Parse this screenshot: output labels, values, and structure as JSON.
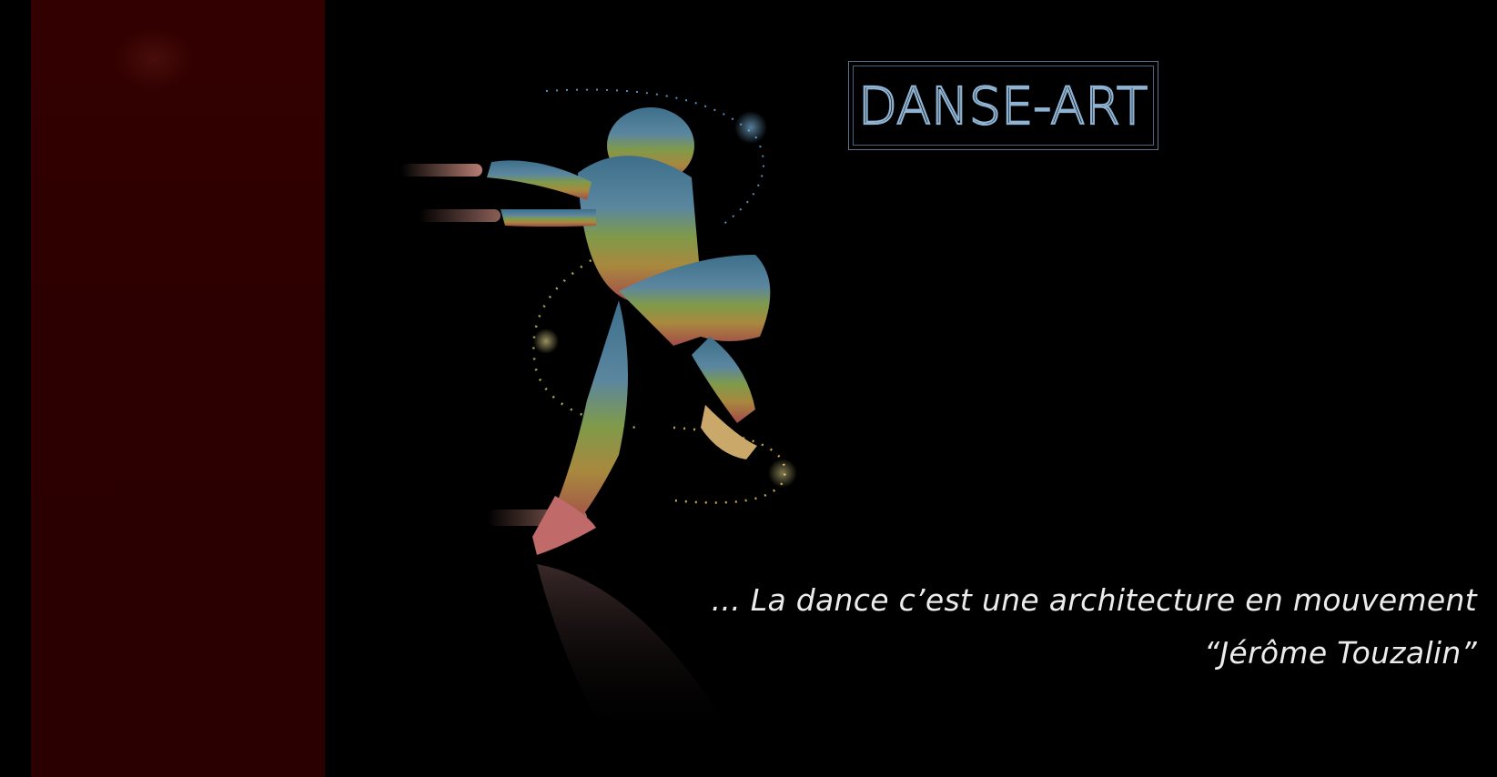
{
  "brand": {
    "logo_text": "DANSE-ART",
    "border_color": "#5b738c",
    "text_color": "#8fb3d2"
  },
  "sidebar": {
    "color": "#310000"
  },
  "hero": {
    "image": "dancer-illustration"
  },
  "quote": {
    "text": "... La dance c’est une architecture en mouvement",
    "author": "“Jérôme Touzalin”"
  }
}
